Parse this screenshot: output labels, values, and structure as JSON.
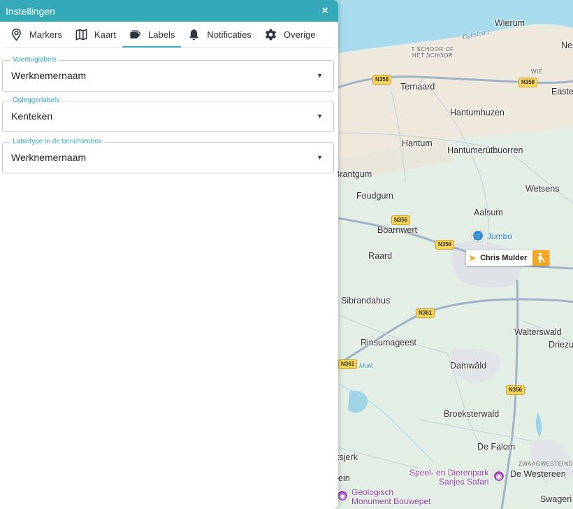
{
  "panel": {
    "title": "Instellingen",
    "close_symbol": "×"
  },
  "tabs": [
    {
      "label": "Markers",
      "icon": "map-pin-icon"
    },
    {
      "label": "Kaart",
      "icon": "folded-map-icon"
    },
    {
      "label": "Labels",
      "icon": "tag-icon",
      "active": true
    },
    {
      "label": "Notificaties",
      "icon": "bell-icon"
    },
    {
      "label": "Overige",
      "icon": "gear-icon"
    }
  ],
  "fields": [
    {
      "legend": "Voertuiglabels",
      "value": "Werknemernaam"
    },
    {
      "legend": "Opleggerlabels",
      "value": "Kenteken"
    },
    {
      "legend": "Labeltype in de berichtenbox",
      "value": "Werknemernaam"
    }
  ],
  "colors": {
    "accent": "#34a9b7",
    "water": "#a8dcec",
    "land": "#e6efe5",
    "vehicle_status": "#f5a623"
  },
  "map": {
    "places": {
      "wierum": "Wierum",
      "nes": "Nes",
      "school": "T SCHOOR OF HET SCHOOR",
      "ternaard": "Ternaard",
      "wie": "WIE",
      "easter": "Easte",
      "hantumhuzen": "Hantumhuzen",
      "hantum": "Hantum",
      "hantumerutbuorren": "Hantumerútbuorren",
      "brantgum": "Brantgum",
      "wetsens": "Wetsens",
      "foudgum": "Foudgum",
      "aalsum": "Aalsum",
      "boarnwert": "Boarnwert",
      "raard": "Raard",
      "sibrandahus": "Sibrandahus",
      "walterswald": "Walterswald",
      "driezum": "Driezu",
      "rinsumageest": "Rinsumageest",
      "damwald": "Damwâld",
      "broeksterwald": "Broeksterwald",
      "defalom": "De Falom",
      "zwaag": "ZWAAGWESTEIND",
      "dewestereen": "De Westereen",
      "tsjerk": "tsjerk",
      "ein": "ein",
      "swagerbosk": "Swageri"
    },
    "water_labels": {
      "dyksfeart": "Dyksfeart",
      "murk": "Murk"
    },
    "pois": {
      "jumbo": "Jumbo",
      "dierenpark_line1": "Speel- en Dierenpark",
      "dierenpark_line2": "Sanjes Safari",
      "geologisch_line1": "Geologisch",
      "geologisch_line2": "Monument Bouwepet"
    },
    "road_shields": [
      "N358",
      "N358",
      "N356",
      "N356",
      "N361",
      "N361",
      "N356"
    ]
  },
  "vehicle": {
    "label": "Chris Mulder",
    "status_icon": "worker-icon"
  }
}
